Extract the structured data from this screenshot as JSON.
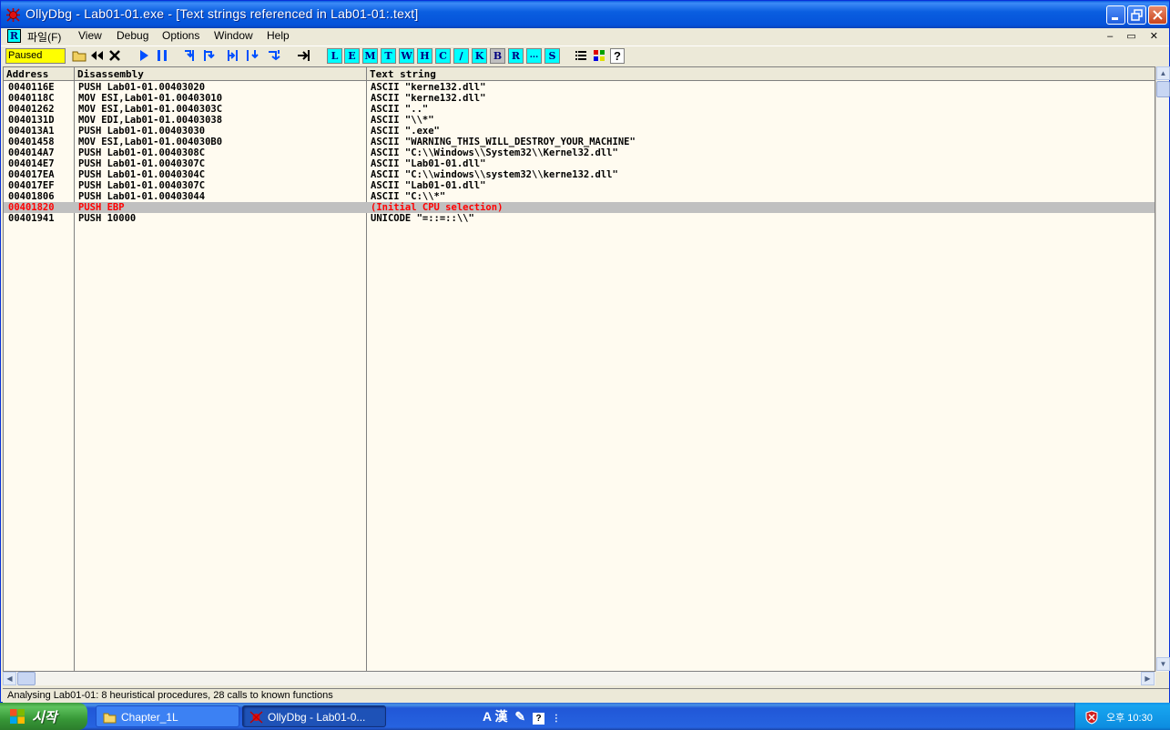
{
  "window": {
    "title": "OllyDbg - Lab01-01.exe - [Text strings referenced in Lab01-01:.text]",
    "minimize_icon": "minimize-icon",
    "maximize_icon": "restore-icon",
    "close_icon": "close-icon"
  },
  "menubar": {
    "r_label": "R",
    "items": [
      "파일(F)",
      "View",
      "Debug",
      "Options",
      "Window",
      "Help"
    ],
    "mdi": "– ▭ ✕"
  },
  "toolbar": {
    "status": "Paused",
    "letters": [
      "L",
      "E",
      "M",
      "T",
      "W",
      "H",
      "C",
      "/",
      "K",
      "B",
      "R",
      "...",
      "S"
    ],
    "help": "?"
  },
  "table": {
    "headers": [
      "Address",
      "Disassembly",
      "Text string"
    ],
    "rows": [
      {
        "address": "0040116E",
        "disassembly": "PUSH Lab01-01.00403020",
        "text": "ASCII \"kerne132.dll\""
      },
      {
        "address": "0040118C",
        "disassembly": "MOV ESI,Lab01-01.00403010",
        "text": "ASCII \"kerne132.dll\""
      },
      {
        "address": "00401262",
        "disassembly": "MOV ESI,Lab01-01.0040303C",
        "text": "ASCII \"..\""
      },
      {
        "address": "0040131D",
        "disassembly": "MOV EDI,Lab01-01.00403038",
        "text": "ASCII \"\\\\*\""
      },
      {
        "address": "004013A1",
        "disassembly": "PUSH Lab01-01.00403030",
        "text": "ASCII \".exe\""
      },
      {
        "address": "00401458",
        "disassembly": "MOV ESI,Lab01-01.004030B0",
        "text": "ASCII \"WARNING_THIS_WILL_DESTROY_YOUR_MACHINE\""
      },
      {
        "address": "004014A7",
        "disassembly": "PUSH Lab01-01.0040308C",
        "text": "ASCII \"C:\\\\Windows\\\\System32\\\\Kernel32.dll\""
      },
      {
        "address": "004014E7",
        "disassembly": "PUSH Lab01-01.0040307C",
        "text": "ASCII \"Lab01-01.dll\""
      },
      {
        "address": "004017EA",
        "disassembly": "PUSH Lab01-01.0040304C",
        "text": "ASCII \"C:\\\\windows\\\\system32\\\\kerne132.dll\""
      },
      {
        "address": "004017EF",
        "disassembly": "PUSH Lab01-01.0040307C",
        "text": "ASCII \"Lab01-01.dll\""
      },
      {
        "address": "00401806",
        "disassembly": "PUSH Lab01-01.00403044",
        "text": "ASCII \"C:\\\\*\""
      },
      {
        "address": "00401820",
        "disassembly": "PUSH EBP",
        "text": "(Initial CPU selection)",
        "selected": true
      },
      {
        "address": "00401941",
        "disassembly": "PUSH 10000",
        "text": "UNICODE \"=::=::\\\\\""
      }
    ],
    "selected_color": "#ff0000"
  },
  "statusbar": {
    "text": "Analysing Lab01-01: 8 heuristical procedures, 28 calls to known functions"
  },
  "taskbar": {
    "start_label": "시작",
    "tasks": [
      {
        "label": "Chapter_1L",
        "icon": "folder-icon"
      },
      {
        "label": "OllyDbg - Lab01-0...",
        "icon": "ollydbg-icon"
      }
    ],
    "ime": "A 漢",
    "clock": "오후 10:30"
  }
}
